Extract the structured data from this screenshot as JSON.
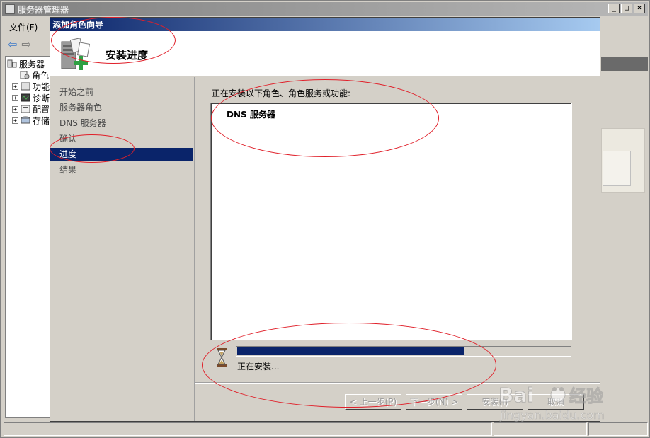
{
  "main_window": {
    "title": "服务器管理器",
    "menu": [
      "文件(F)"
    ],
    "tree": [
      {
        "label": "服务器",
        "expander": "",
        "icon": "server-tree-icon"
      },
      {
        "label": "角色",
        "expander": "",
        "icon": "roles-icon"
      },
      {
        "label": "功能",
        "expander": "+",
        "icon": "features-icon"
      },
      {
        "label": "诊断",
        "expander": "+",
        "icon": "diagnostics-icon"
      },
      {
        "label": "配置",
        "expander": "+",
        "icon": "configuration-icon"
      },
      {
        "label": "存储",
        "expander": "+",
        "icon": "storage-icon"
      }
    ]
  },
  "wizard": {
    "title": "添加角色向导",
    "header_title": "安装进度",
    "nav_items": [
      "开始之前",
      "服务器角色",
      "DNS 服务器",
      "确认",
      "进度",
      "结果"
    ],
    "active_nav": "进度",
    "content_label": "正在安装以下角色、角色服务或功能:",
    "install_items": [
      "DNS 服务器"
    ],
    "progress_fraction": 0.68,
    "status_text": "正在安装...",
    "buttons": {
      "prev": "< 上一步(P)",
      "next": "下一步(N) >",
      "install": "安装(I)",
      "cancel": "取消"
    }
  },
  "watermark": {
    "brand": "Bai",
    "brand_suffix": "经验",
    "url": "jingyan.baidu.com"
  },
  "colors": {
    "title_active": "#0a246a",
    "title_inactive": "#808080",
    "annotation": "#e0202a"
  }
}
